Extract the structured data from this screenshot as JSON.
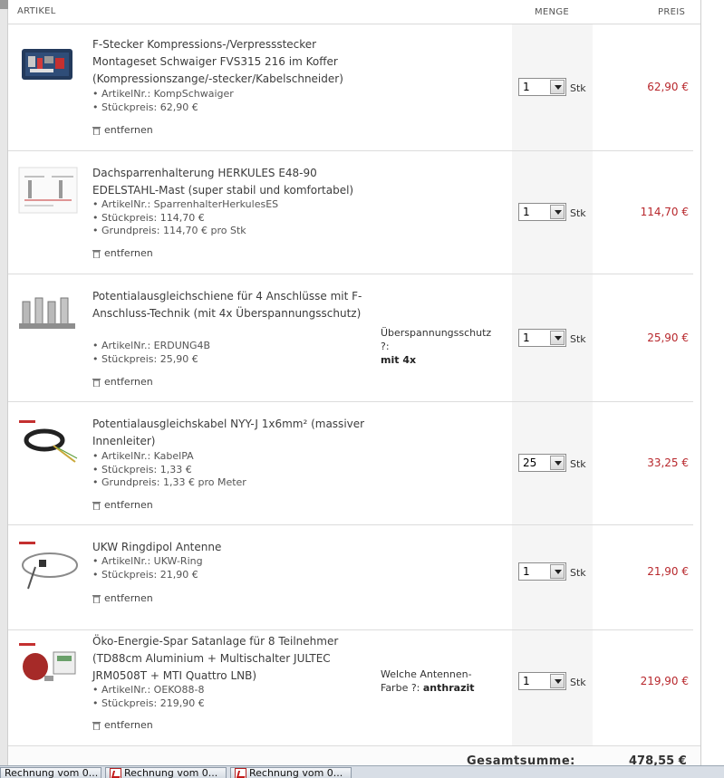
{
  "header": {
    "article": "ARTIKEL",
    "menge": "MENGE",
    "preis": "PREIS"
  },
  "remove_label": "entfernen",
  "unit_label": "Stk",
  "items": [
    {
      "title": "F-Stecker Kompressions-/Verpressstecker Montageset Schwaiger FVS315 216 im Koffer (Kompressionszange/-stecker/Kabelschneider)",
      "details": [
        "ArtikelNr.: KompSchwaiger",
        "Stückpreis: 62,90 €"
      ],
      "option_label": "",
      "option_value": "",
      "qty": "1",
      "price": "62,90 €",
      "image": "tool-case-image"
    },
    {
      "title": "Dachsparrenhalterung HERKULES E48-90 EDELSTAHL-Mast (super stabil und komfortabel)",
      "details": [
        "ArtikelNr.: SparrenhalterHerkulesES",
        "Stückpreis: 114,70 €",
        "Grundpreis: 114,70 € pro Stk"
      ],
      "option_label": "",
      "option_value": "",
      "qty": "1",
      "price": "114,70 €",
      "image": "mount-diagram-image"
    },
    {
      "title": "Potentialausgleichschiene für 4 Anschlüsse mit F-Anschluss-Technik (mit 4x Überspannungsschutz)",
      "details": [
        "ArtikelNr.: ERDUNG4B",
        "Stückpreis: 25,90 €"
      ],
      "option_label": "Überspannungsschutz ?:",
      "option_value": "mit 4x",
      "qty": "1",
      "price": "25,90 €",
      "image": "ground-block-image"
    },
    {
      "title": "Potentialausgleichskabel NYY-J 1x6mm² (massiver Innenleiter)",
      "details": [
        "ArtikelNr.: KabelPA",
        "Stückpreis: 1,33 €",
        "Grundpreis: 1,33 € pro Meter"
      ],
      "option_label": "",
      "option_value": "",
      "qty": "25",
      "price": "33,25 €",
      "image": "cable-coil-image"
    },
    {
      "title": "UKW Ringdipol Antenne",
      "details": [
        "ArtikelNr.: UKW-Ring",
        "Stückpreis: 21,90 €"
      ],
      "option_label": "",
      "option_value": "",
      "qty": "1",
      "price": "21,90 €",
      "image": "ring-antenna-image"
    },
    {
      "title": "Öko-Energie-Spar Satanlage für 8 Teilnehmer (TD88cm Aluminium + Multischalter JULTEC JRM0508T + MTI Quattro LNB)",
      "details": [
        "ArtikelNr.: OEKO88-8",
        "Stückpreis: 219,90 €"
      ],
      "option_label": "Welche Antennen-Farbe ?:",
      "option_value": "anthrazit",
      "qty": "1",
      "price": "219,90 €",
      "image": "sat-dish-image"
    }
  ],
  "total": {
    "label": "Gesamtsumme:",
    "value": "478,55 €"
  },
  "taskbar": [
    {
      "label": "Rechnung vom 0...",
      "icon": "document-icon"
    },
    {
      "label": "Rechnung vom 0...",
      "icon": "pdf-icon"
    },
    {
      "label": "Rechnung vom 0...",
      "icon": "pdf-icon"
    }
  ]
}
